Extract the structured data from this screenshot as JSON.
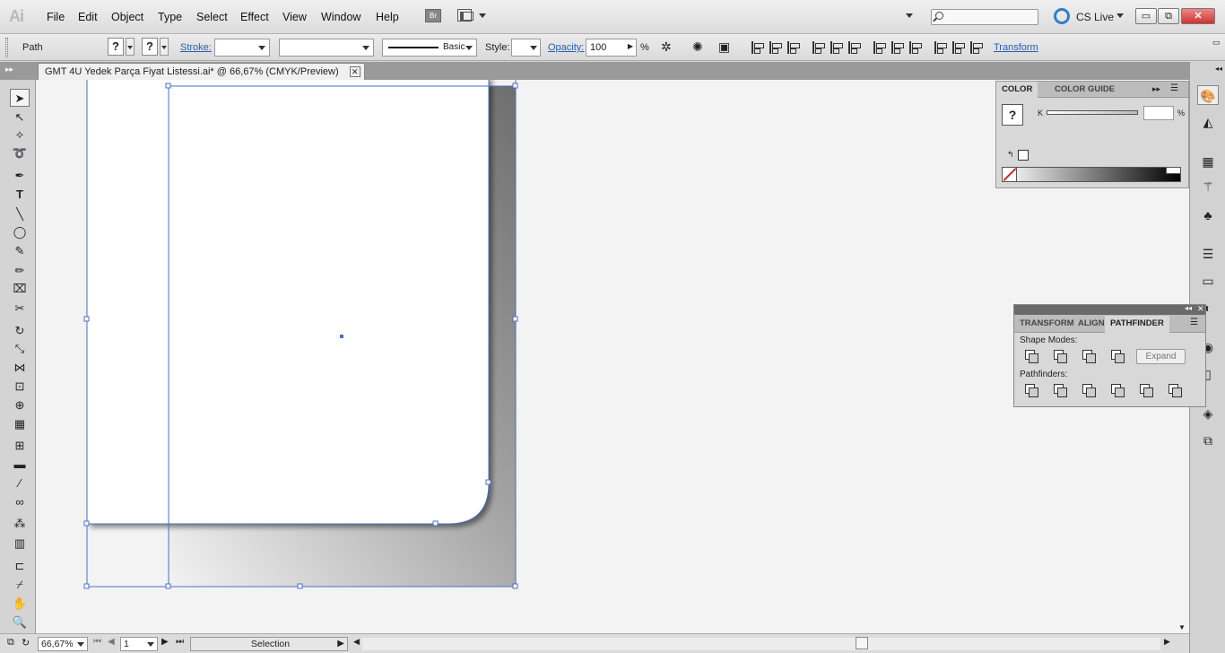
{
  "app": {
    "logo": "Ai"
  },
  "menu": [
    "File",
    "Edit",
    "Object",
    "Type",
    "Select",
    "Effect",
    "View",
    "Window",
    "Help"
  ],
  "bridge_label": "Br",
  "cs_live": "CS Live",
  "window_controls": {
    "minimize": "▭",
    "restore": "⧉",
    "close": "✕"
  },
  "control": {
    "selection_type": "Path",
    "fill_swatch": "?",
    "stroke_swatch": "?",
    "stroke_label": "Stroke:",
    "stroke_weight": "",
    "stroke_style": "",
    "profile_label": "Basic",
    "style_label": "Style:",
    "opacity_label": "Opacity:",
    "opacity_value": "100",
    "opacity_unit": "%",
    "transform_label": "Transform"
  },
  "document_tab": {
    "title": "GMT 4U Yedek Parça Fiyat Listessi.ai* @ 66,67% (CMYK/Preview)",
    "close": "✕"
  },
  "status": {
    "zoom": "66,67%",
    "artboard": "1",
    "tool": "Selection"
  },
  "color_panel": {
    "tabs": [
      "COLOR",
      "COLOR GUIDE"
    ],
    "channel_label": "K",
    "channel_value": "",
    "unit": "%",
    "swatch_glyph": "?"
  },
  "pathfinder_panel": {
    "tabs": [
      "TRANSFORM",
      "ALIGN",
      "PATHFINDER"
    ],
    "shape_modes_label": "Shape Modes:",
    "pathfinders_label": "Pathfinders:",
    "expand_label": "Expand"
  },
  "colors": {
    "selection": "#4a6fc0",
    "close_button": "#c33333",
    "cs_live_accent": "#2f7fc9"
  }
}
